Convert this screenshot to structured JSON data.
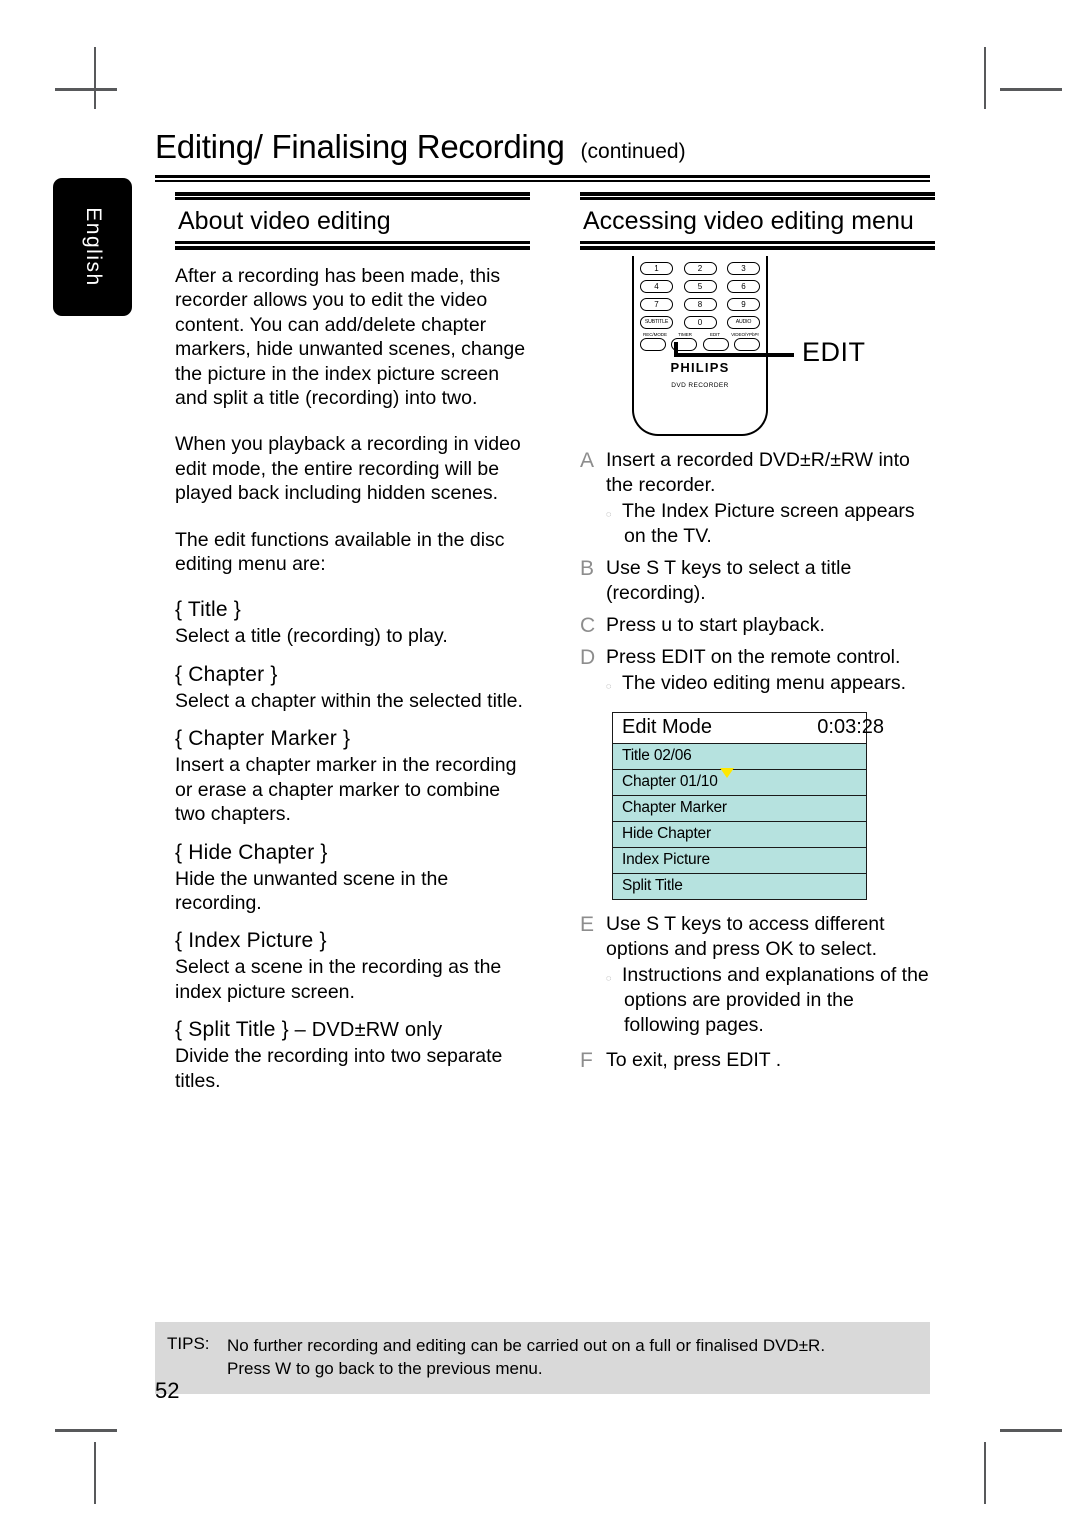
{
  "sidebar": {
    "language_tab": "English"
  },
  "header": {
    "title": "Editing/ Finalising Recording",
    "continued": "(continued)"
  },
  "left_column": {
    "section_heading": "About video editing",
    "paragraphs": [
      "After a recording has been made, this recorder allows you to edit the video content. You can add/delete chapter markers, hide unwanted scenes, change the picture in the index picture screen and split a title (recording) into two.",
      "When you playback a recording in video edit mode, the entire recording will be played back including hidden scenes.",
      "The edit functions available in the disc editing menu are:"
    ],
    "functions": [
      {
        "name": "{ Title }",
        "suffix": "",
        "description": "Select a title (recording) to play."
      },
      {
        "name": "{ Chapter }",
        "suffix": "",
        "description": "Select a chapter within the selected title."
      },
      {
        "name": "{ Chapter Marker }",
        "suffix": "",
        "description": "Insert a chapter marker in the recording or erase a chapter marker to combine two chapters."
      },
      {
        "name": "{ Hide Chapter }",
        "suffix": "",
        "description": "Hide the unwanted scene in the recording."
      },
      {
        "name": "{ Index Picture }",
        "suffix": "",
        "description": "Select a scene in the recording as the index picture screen."
      },
      {
        "name": "{ Split Title }",
        "suffix": " – DVD±RW only",
        "description": "Divide the recording into two separate titles."
      }
    ]
  },
  "right_column": {
    "section_heading": "Accessing video editing menu",
    "remote": {
      "brand": "PHILIPS",
      "sub_brand": "DVD RECORDER",
      "numeric_rows": [
        [
          "1",
          "2",
          "3"
        ],
        [
          "4",
          "5",
          "6"
        ],
        [
          "7",
          "8",
          "9"
        ]
      ],
      "function_row": [
        "SUBTITLE",
        "0",
        "AUDIO"
      ],
      "bottom_labels": [
        "REC/MODE",
        "TIMER",
        "EDIT",
        "VIDEO/YPbPr"
      ],
      "callout_label": "EDIT"
    },
    "steps": [
      {
        "letter": "A",
        "text": "Insert a recorded DVD±R/±RW into the recorder.",
        "sub": "The Index Picture screen appears on the TV."
      },
      {
        "letter": "B",
        "text": "Use S T keys to select a title (recording).",
        "sub": ""
      },
      {
        "letter": "C",
        "text": "Press u  to start playback.",
        "sub": ""
      },
      {
        "letter": "D",
        "text": "Press EDIT on the remote control.",
        "sub": "The video editing menu appears."
      },
      {
        "letter": "E",
        "text": "Use S T keys to access different options and press OK to select.",
        "sub": "Instructions and explanations of the options are provided in the following pages."
      },
      {
        "letter": "F",
        "text": "To exit, press EDIT .",
        "sub": ""
      }
    ],
    "osd": {
      "title": "Edit Mode",
      "time": "0:03:28",
      "rows": [
        {
          "label": "Title 02/06",
          "marker": false
        },
        {
          "label": "Chapter 01/10",
          "marker": true
        },
        {
          "label": "Chapter Marker",
          "marker": false
        },
        {
          "label": "Hide Chapter",
          "marker": false
        },
        {
          "label": "Index Picture",
          "marker": false
        },
        {
          "label": "Split Title",
          "marker": false
        }
      ],
      "colors": {
        "row_background": "#b6e2df",
        "marker": "#ffe800",
        "border": "#1a1a1a"
      }
    }
  },
  "footer": {
    "tips_label": "TIPS:",
    "tips_line1": "No further recording and editing can be carried out on a full or finalised DVD±R.",
    "tips_line2": "Press W to go back to the previous menu.",
    "page_number": "52"
  }
}
